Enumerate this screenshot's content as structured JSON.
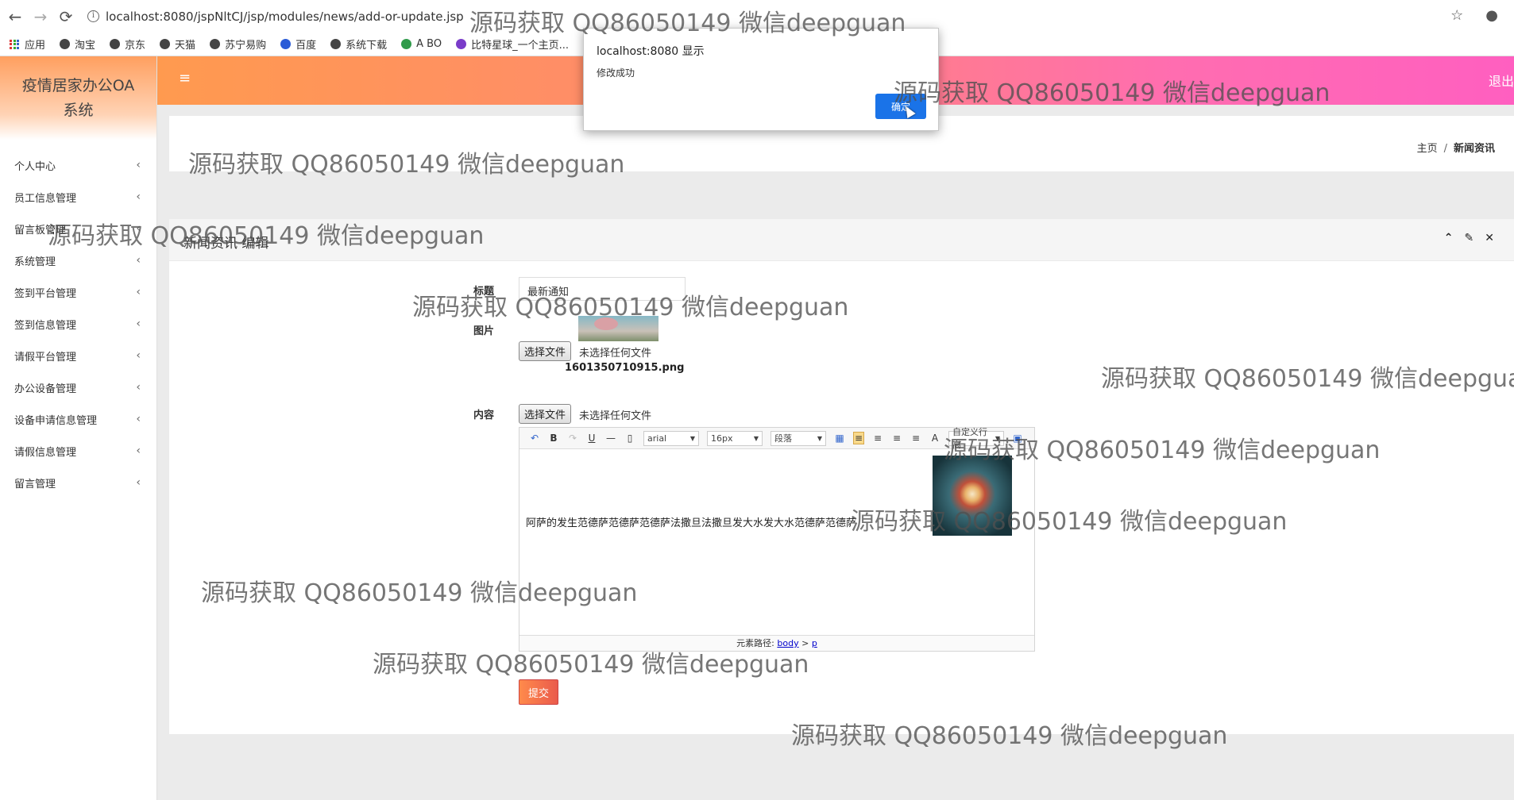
{
  "browser": {
    "url": "localhost:8080/jspNltCJ/jsp/modules/news/add-or-update.jsp",
    "back": "←",
    "forward": "→",
    "reload": "⟳",
    "star": "☆",
    "account": "●"
  },
  "bookmarks": [
    "应用",
    "淘宝",
    "京东",
    "天猫",
    "苏宁易购",
    "百度",
    "系统下载",
    "A BO",
    "比特星球_一个主页..."
  ],
  "app": {
    "logo_line1": "疫情居家办公OA",
    "logo_line2": "系统",
    "logout": "退出",
    "hamburger": "≡"
  },
  "sidebar": {
    "items": [
      {
        "label": "个人中心"
      },
      {
        "label": "员工信息管理"
      },
      {
        "label": "留言板管理"
      },
      {
        "label": "系统管理"
      },
      {
        "label": "签到平台管理"
      },
      {
        "label": "签到信息管理"
      },
      {
        "label": "请假平台管理"
      },
      {
        "label": "办公设备管理"
      },
      {
        "label": "设备申请信息管理"
      },
      {
        "label": "请假信息管理"
      },
      {
        "label": "留言管理"
      }
    ],
    "chevron": "‹"
  },
  "breadcrumb": {
    "home": "主页",
    "sep": "/",
    "current": "新闻资讯"
  },
  "card": {
    "title": "新闻资讯 编辑",
    "tools": [
      "⌃",
      "✎",
      "✕"
    ]
  },
  "form": {
    "title_label": "标题",
    "title_value": "最新通知",
    "image_label": "图片",
    "choose_file": "选择文件",
    "no_file": "未选择任何文件",
    "image_filename": "1601350710915.png",
    "content_label": "内容",
    "submit": "提交"
  },
  "editor": {
    "font": "arial",
    "size": "16px",
    "paragraph": "段落",
    "font_color_icon": "A",
    "line_height": "自定义行高",
    "content_text": "阿萨的发生范德萨范德萨范德萨法撒旦法撒旦发大水发大水范德萨范德萨",
    "footer_prefix": "元素路径:",
    "footer_body": "body",
    "footer_gt": ">",
    "footer_p": "p"
  },
  "dialog": {
    "title": "localhost:8080 显示",
    "message": "修改成功",
    "ok": "确定"
  },
  "watermark": "源码获取 QQ86050149 微信deepguan",
  "watermark_partial": "源码获取 QQ86050149 微信deepgua"
}
